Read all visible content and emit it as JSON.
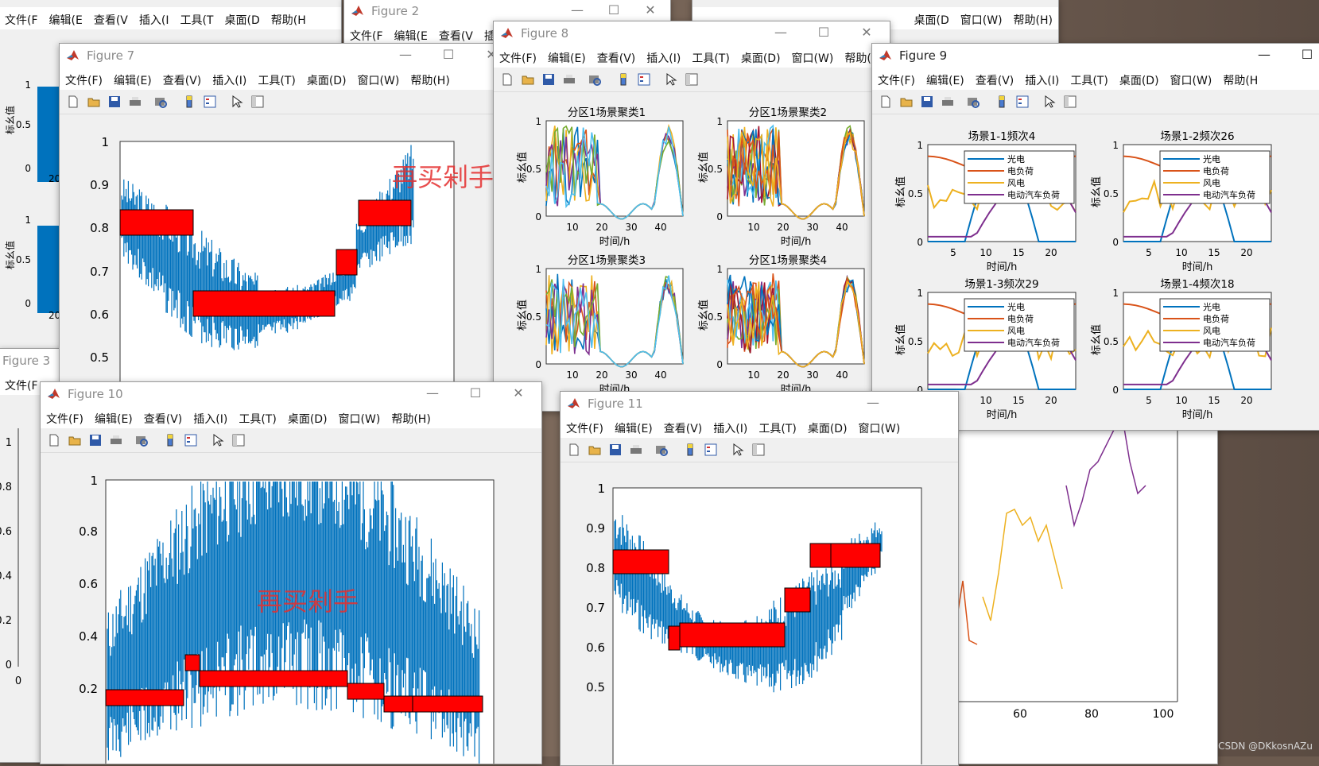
{
  "menus": {
    "file": "文件(F)",
    "edit": "编辑(E)",
    "view": "查看(V)",
    "insert": "插入(I)",
    "tools": "工具(T)",
    "desktop": "桌面(D)",
    "window": "窗口(W)",
    "help": "帮助(H)",
    "trunc": {
      "file": "文件(F",
      "edit": "编辑(E",
      "view": "查看(V",
      "insert": "插入(I",
      "tools": "工具(T",
      "desktop": "桌面(D",
      "window": "窗口(W",
      "help": "帮助(H"
    }
  },
  "figures": {
    "fig2": {
      "title": "Figure 2"
    },
    "fig3": {
      "title": "Figure 3"
    },
    "fig7": {
      "title": "Figure 7",
      "yticks": [
        "1",
        "0.9",
        "0.8",
        "0.7",
        "0.6",
        "0.5"
      ],
      "watermark": "再买剁手"
    },
    "fig8": {
      "title": "Figure 8",
      "subplots": [
        {
          "title": "分区1场景聚类1",
          "xlabel": "时间/h",
          "ylabel": "标幺值"
        },
        {
          "title": "分区1场景聚类2",
          "xlabel": "时间/h",
          "ylabel": "标幺值"
        },
        {
          "title": "分区1场景聚类3",
          "xlabel": "时间/h",
          "ylabel": "标幺值"
        },
        {
          "title": "分区1场景聚类4",
          "xlabel": "时间/h",
          "ylabel": "标幺值"
        }
      ],
      "xticks": [
        "10",
        "20",
        "30",
        "40"
      ],
      "yticks": [
        "1",
        "0.5",
        "0"
      ]
    },
    "fig9": {
      "title": "Figure 9",
      "subplots": [
        {
          "title": "场景1-1频次4",
          "xlabel": "时间/h",
          "ylabel": "标幺值"
        },
        {
          "title": "场景1-2频次26",
          "xlabel": "时间/h",
          "ylabel": "标幺值"
        },
        {
          "title": "场景1-3频次29",
          "xlabel": "时间/h",
          "ylabel": "标幺值"
        },
        {
          "title": "场景1-4频次18",
          "xlabel": "时间/h",
          "ylabel": "标幺值"
        }
      ],
      "legend": [
        "光电",
        "电负荷",
        "风电",
        "电动汽车负荷"
      ],
      "xticks": [
        "5",
        "10",
        "15",
        "20"
      ],
      "yticks": [
        "1",
        "0.5",
        "0"
      ]
    },
    "fig10": {
      "title": "Figure 10",
      "yticks": [
        "1",
        "0.8",
        "0.6",
        "0.4",
        "0.2"
      ],
      "watermark": "再买剁手"
    },
    "fig11": {
      "title": "Figure 11",
      "yticks": [
        "1",
        "0.9",
        "0.8",
        "0.7",
        "0.6",
        "0.5"
      ]
    },
    "left": {
      "yticks": [
        "1",
        "0.5",
        "0",
        "1",
        "0.5",
        "0"
      ],
      "ylabel": "标幺值",
      "xtick": "20"
    },
    "leftbottom": {
      "yticks": [
        "1",
        "0.8",
        "0.6",
        "0.4",
        "0.2",
        "0"
      ],
      "xtick": "0"
    },
    "rightplot": {
      "xticks": [
        "60",
        "80",
        "100"
      ]
    }
  },
  "colors": {
    "blue": "#0072bd",
    "orange": "#d95319",
    "yellow": "#edb120",
    "purple": "#7e2f8e",
    "green": "#77ac30",
    "cyan": "#4dbeee",
    "red": "#ff0000",
    "accent": "#e53030"
  },
  "footer": {
    "csdn": "CSDN @DKkosnAZu"
  }
}
